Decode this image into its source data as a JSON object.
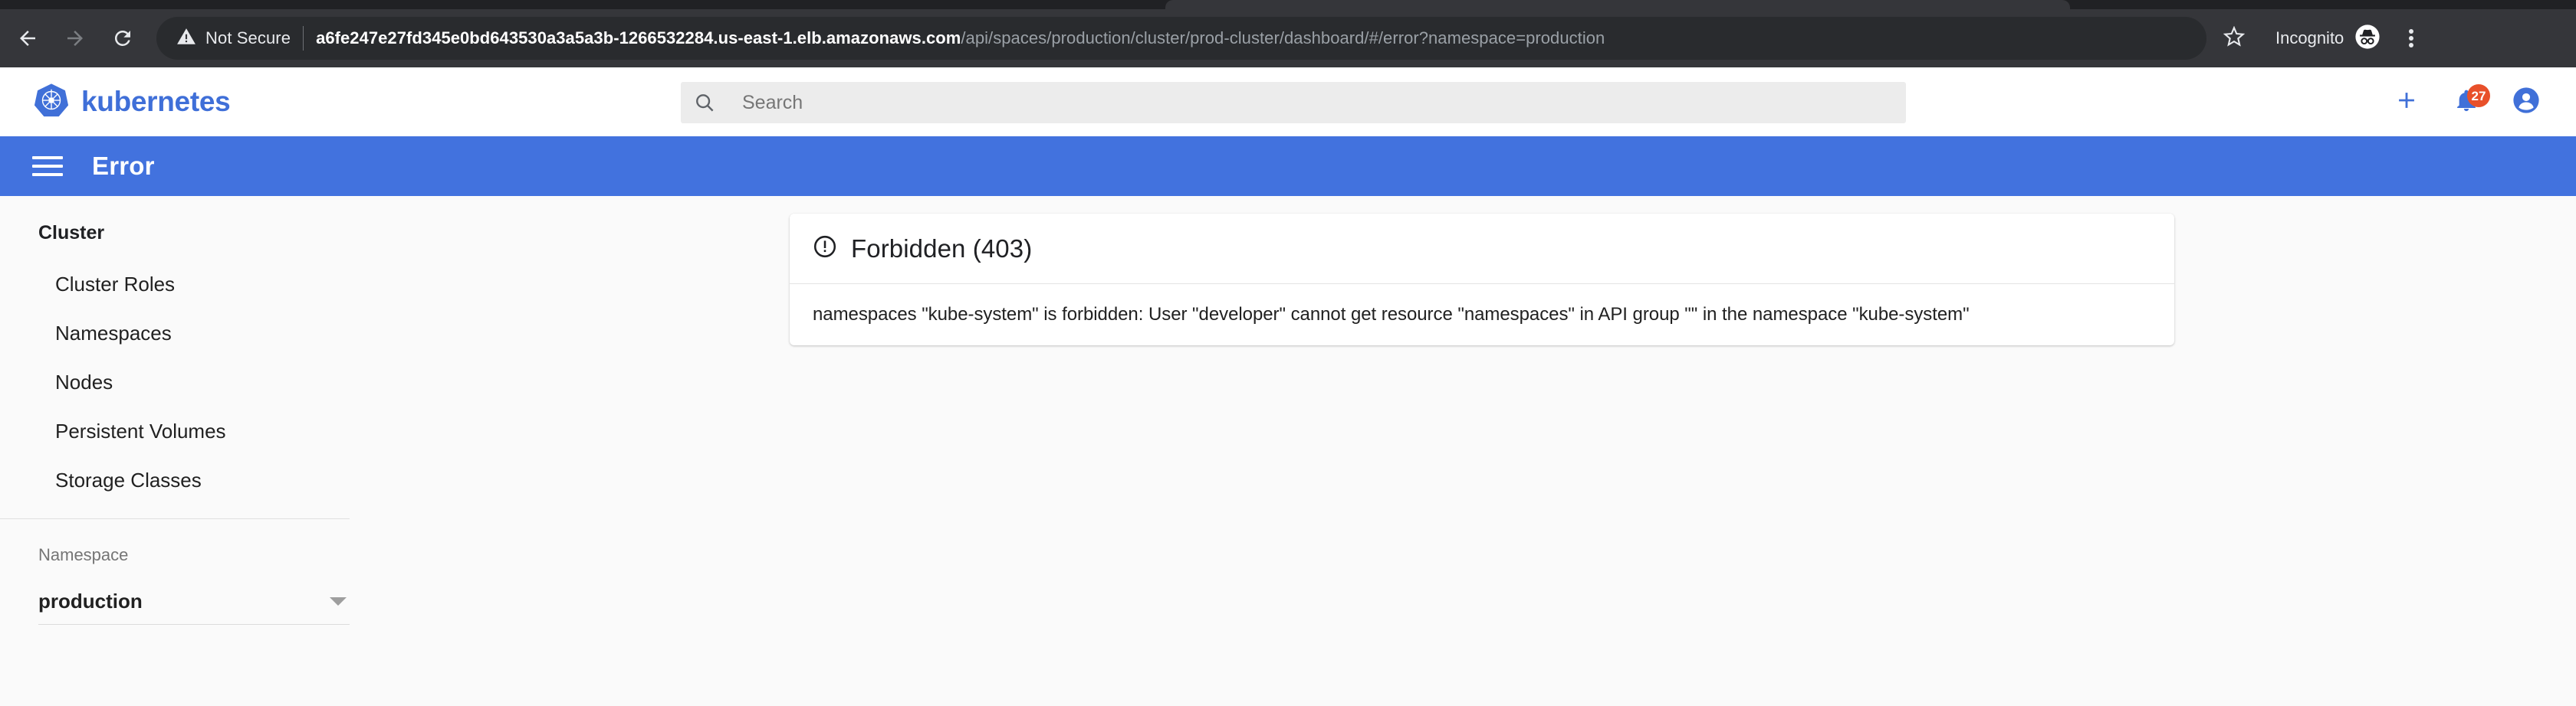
{
  "browser": {
    "back_icon": "back-arrow-icon",
    "forward_icon": "forward-arrow-icon",
    "reload_icon": "reload-icon",
    "security_label": "Not Secure",
    "security_icon": "warning-triangle-icon",
    "url_origin": "a6fe247e27fd345e0bd643530a3a5a3b-1266532284.us-east-1.elb.amazonaws.com",
    "url_path": "/api/spaces/production/cluster/prod-cluster/dashboard/#/error?namespace=production",
    "bookmark_icon": "star-icon",
    "profile_label": "Incognito",
    "profile_icon": "incognito-hat-icon",
    "menu_icon": "kebab-menu-icon",
    "colors": {
      "toolbar_bg": "#35363a",
      "omnibox_bg": "#292b2e",
      "tabstrip_bg": "#202124",
      "url_path_text": "#9aa0a6"
    }
  },
  "topbar": {
    "brand_name": "kubernetes",
    "brand_icon": "kubernetes-helm-logo",
    "brand_color": "#3f6fd8",
    "search": {
      "icon": "search-icon",
      "placeholder": "Search",
      "value": ""
    },
    "actions": [
      {
        "name": "create-button",
        "icon": "plus-icon"
      },
      {
        "name": "notifications-button",
        "icon": "bell-icon",
        "badge": "27",
        "badge_color": "#e8502a"
      },
      {
        "name": "account-button",
        "icon": "account-circle-icon"
      }
    ]
  },
  "page_bar": {
    "menu_icon": "hamburger-menu-icon",
    "title": "Error",
    "background_color": "#4272de"
  },
  "sidebar": {
    "section_title": "Cluster",
    "items": [
      {
        "label": "Cluster Roles"
      },
      {
        "label": "Namespaces"
      },
      {
        "label": "Nodes"
      },
      {
        "label": "Persistent Volumes"
      },
      {
        "label": "Storage Classes"
      }
    ],
    "namespace": {
      "label": "Namespace",
      "selected": "production",
      "caret_icon": "chevron-down-icon"
    }
  },
  "main": {
    "error_card": {
      "icon": "error-outline-icon",
      "title": "Forbidden (403)",
      "message": "namespaces \"kube-system\" is forbidden: User \"developer\" cannot get resource \"namespaces\" in API group \"\" in the namespace \"kube-system\""
    }
  }
}
